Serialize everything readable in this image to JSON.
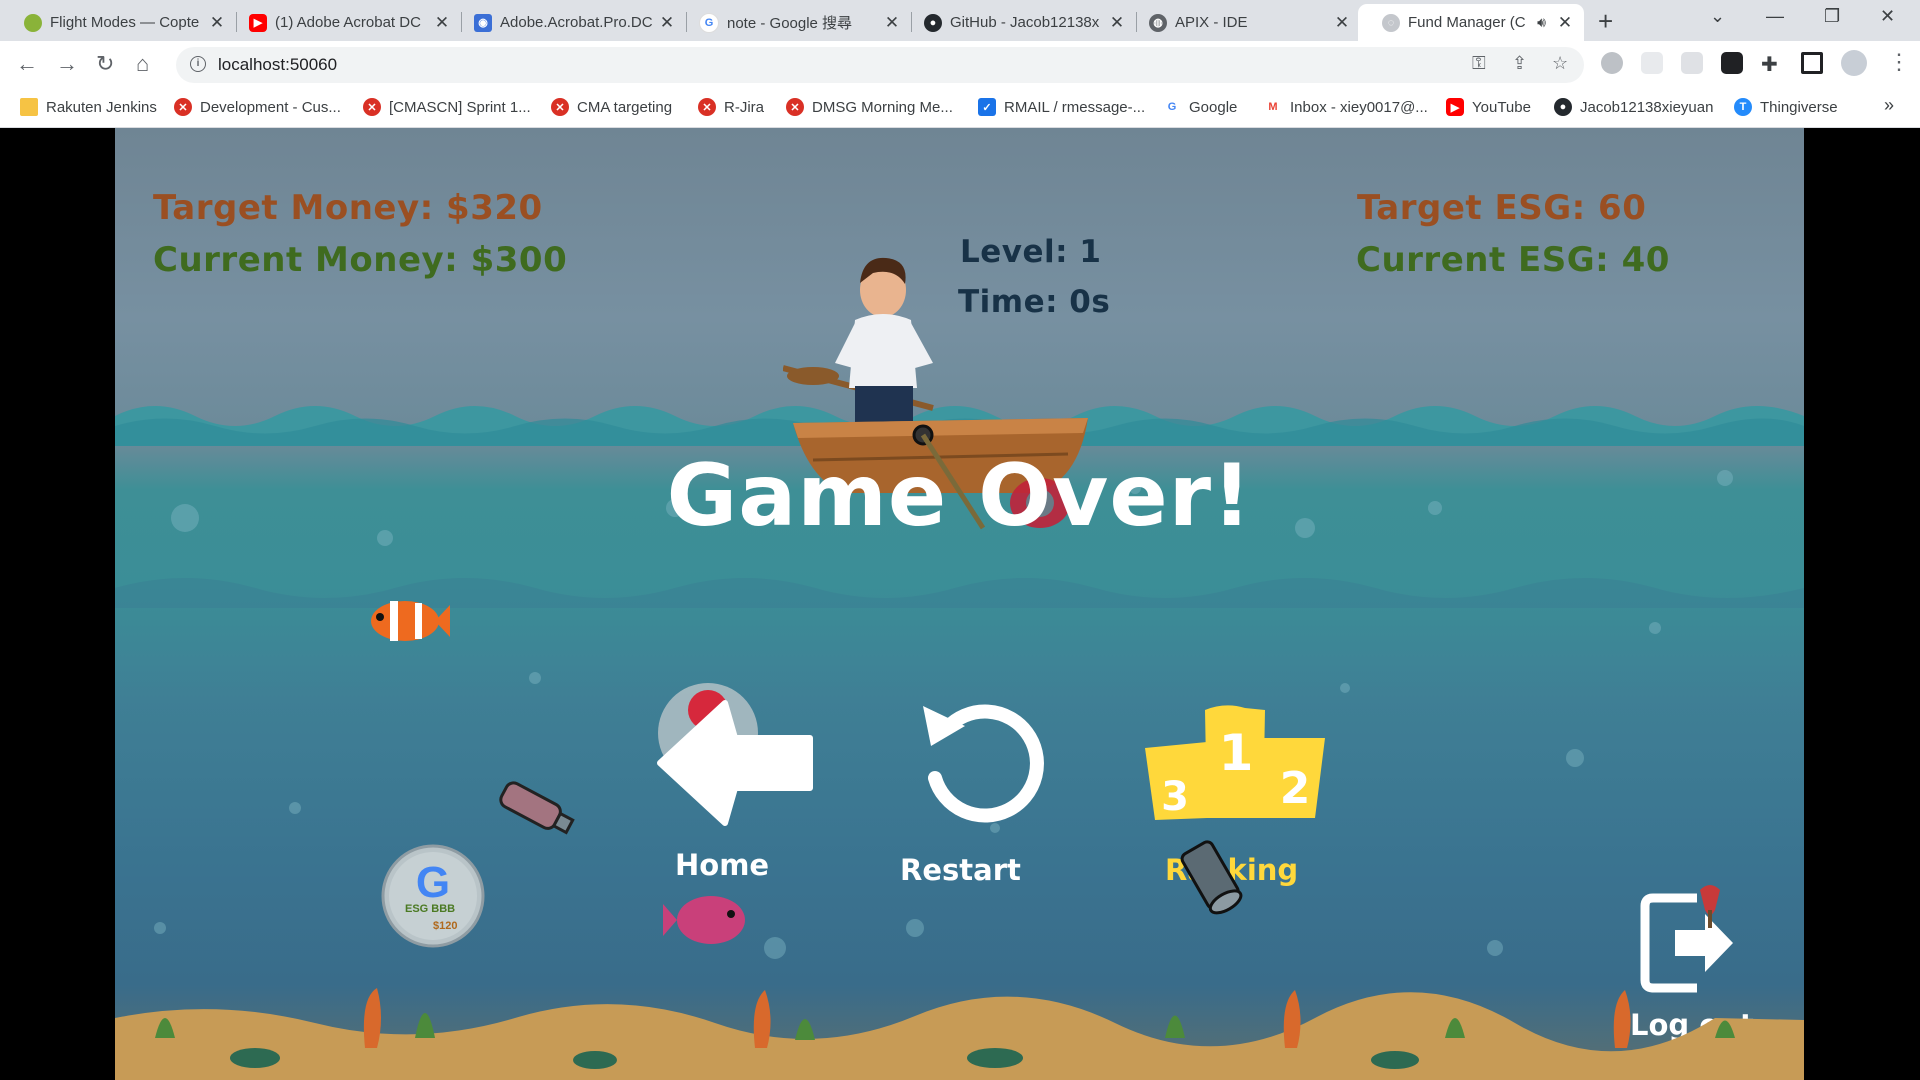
{
  "browser": {
    "tabs": [
      {
        "title": "Flight Modes — Copte",
        "favicon": "flight-modes-favicon",
        "color": "#8ab339"
      },
      {
        "title": "(1) Adobe Acrobat DC",
        "favicon": "youtube-favicon",
        "color": "#ff0000"
      },
      {
        "title": "Adobe.Acrobat.Pro.DC",
        "favicon": "acrobat-site-favicon",
        "color": "#3b6fd6"
      },
      {
        "title": "note - Google 搜尋",
        "favicon": "google-favicon",
        "color": "#4285f4"
      },
      {
        "title": "GitHub - Jacob12138x",
        "favicon": "github-favicon",
        "color": "#24292e"
      },
      {
        "title": "APIX - IDE",
        "favicon": "globe-favicon",
        "color": "#5f6368"
      },
      {
        "title": "Fund Manager (C",
        "favicon": "fund-manager-favicon",
        "color": "#9aa0a6",
        "active": true
      }
    ],
    "url": "localhost:50060",
    "bookmarks": [
      {
        "label": "Rakuten Jenkins",
        "icon": "folder-icon",
        "color": "#f6c344"
      },
      {
        "label": "Development - Cus...",
        "icon": "jira-x-icon",
        "color": "#d93025"
      },
      {
        "label": "[CMASCN] Sprint 1...",
        "icon": "jira-x-icon",
        "color": "#d93025"
      },
      {
        "label": "CMA targeting",
        "icon": "jira-x-icon",
        "color": "#d93025"
      },
      {
        "label": "R-Jira",
        "icon": "jira-x-icon",
        "color": "#d93025"
      },
      {
        "label": "DMSG Morning Me...",
        "icon": "jira-x-icon",
        "color": "#d93025"
      },
      {
        "label": "RMAIL / rmessage-...",
        "icon": "shield-icon",
        "color": "#1a73e8"
      },
      {
        "label": "Google",
        "icon": "google-icon",
        "color": "#4285f4"
      },
      {
        "label": "Inbox - xiey0017@...",
        "icon": "gmail-icon",
        "color": "#ea4335"
      },
      {
        "label": "YouTube",
        "icon": "youtube-icon",
        "color": "#ff0000"
      },
      {
        "label": "Jacob12138xieyuan",
        "icon": "github-icon",
        "color": "#24292e"
      },
      {
        "label": "Thingiverse",
        "icon": "thingiverse-icon",
        "color": "#248bfb"
      }
    ],
    "more_bookmarks": "»"
  },
  "game": {
    "target_money": "Target Money: $320",
    "current_money": "Current Money: $300",
    "target_esg": "Target ESG: 60",
    "current_esg": "Current ESG: 40",
    "level": "Level: 1",
    "time": "Time: 0s",
    "title": "Game Over!",
    "home_label": "Home",
    "restart_label": "Restart",
    "ranking_label": "Ranking",
    "logout_label": "Log out",
    "coin": {
      "rating": "ESG BBB",
      "price": "$120"
    },
    "podium": {
      "first": "1",
      "second": "2",
      "third": "3"
    },
    "colors": {
      "money_target": "#9a4f22",
      "money_current": "#3f6b1f",
      "ranking": "#ffd83b"
    }
  }
}
